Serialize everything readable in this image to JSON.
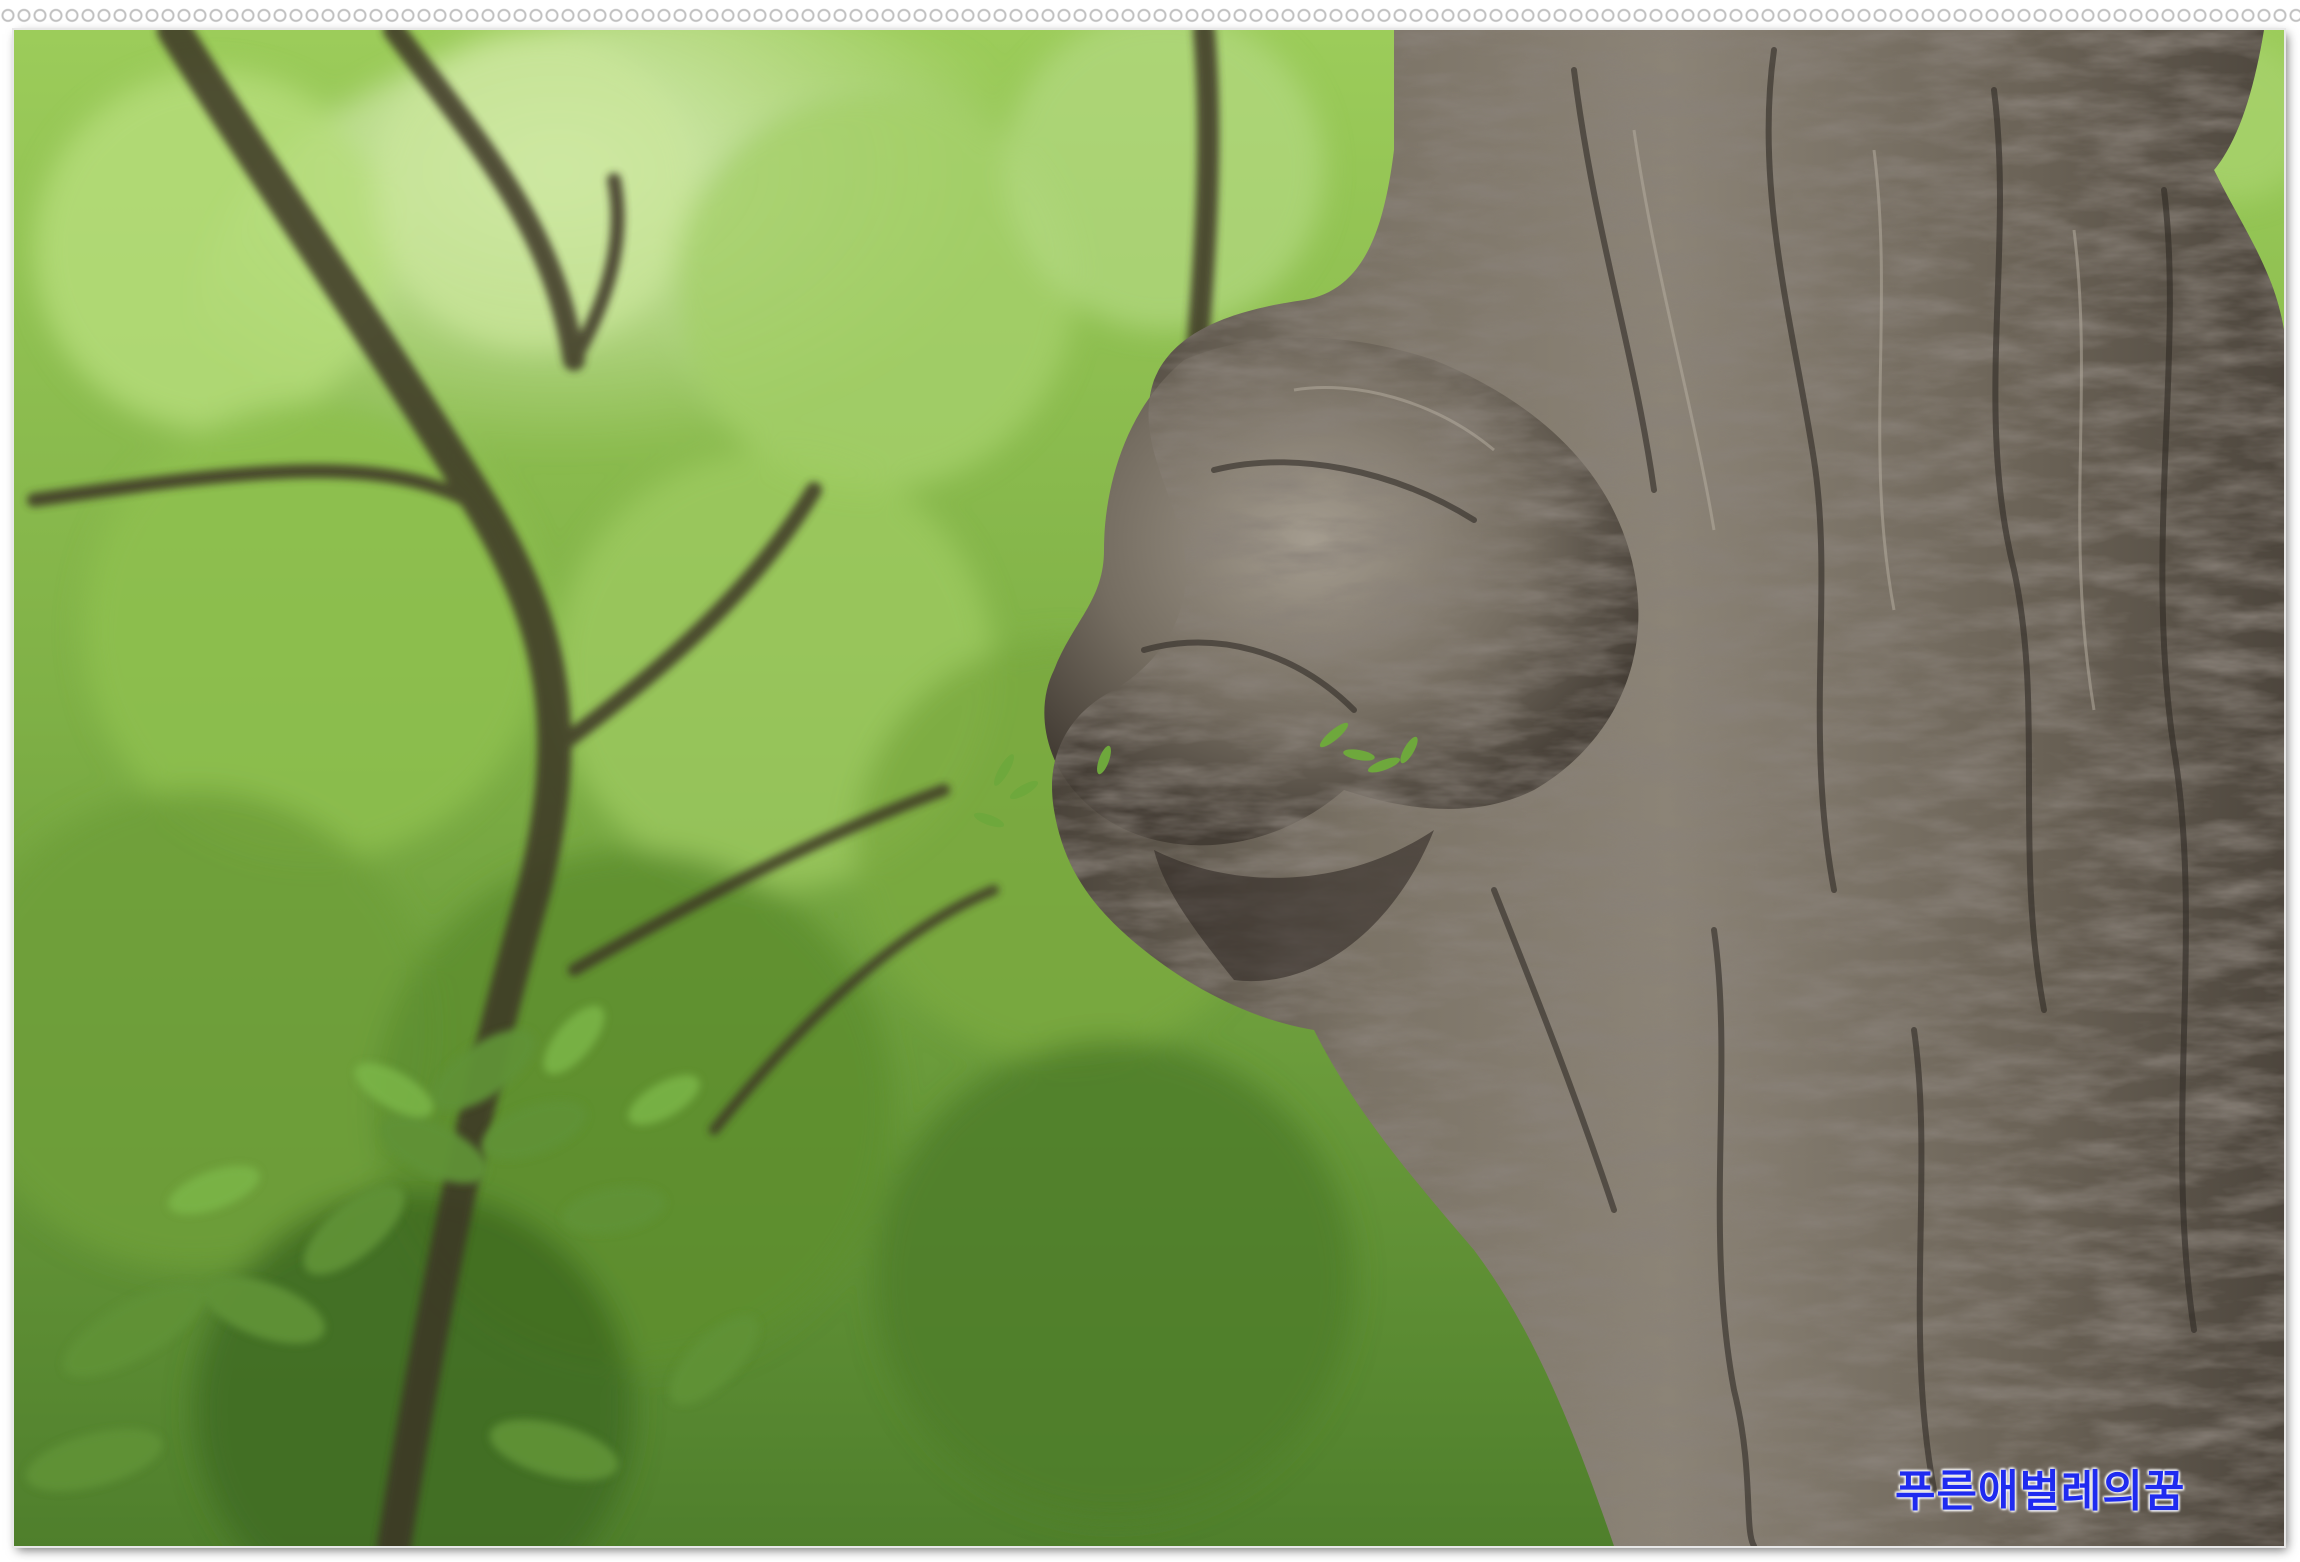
{
  "watermark": {
    "text": "푸른애벌레의꿈",
    "color": "#1f2bf0"
  },
  "photo": {
    "subject_icons": [
      "tree-trunk",
      "tree-burl",
      "foliage"
    ],
    "colors": {
      "foliage_light": "#a9d36a",
      "foliage_mid": "#6f9a3c",
      "foliage_dark": "#3f6a22",
      "bark_light": "#9a9184",
      "bark_mid": "#6e665b",
      "bark_dark": "#3e3831",
      "frame_border": "#e8e8e8"
    }
  }
}
